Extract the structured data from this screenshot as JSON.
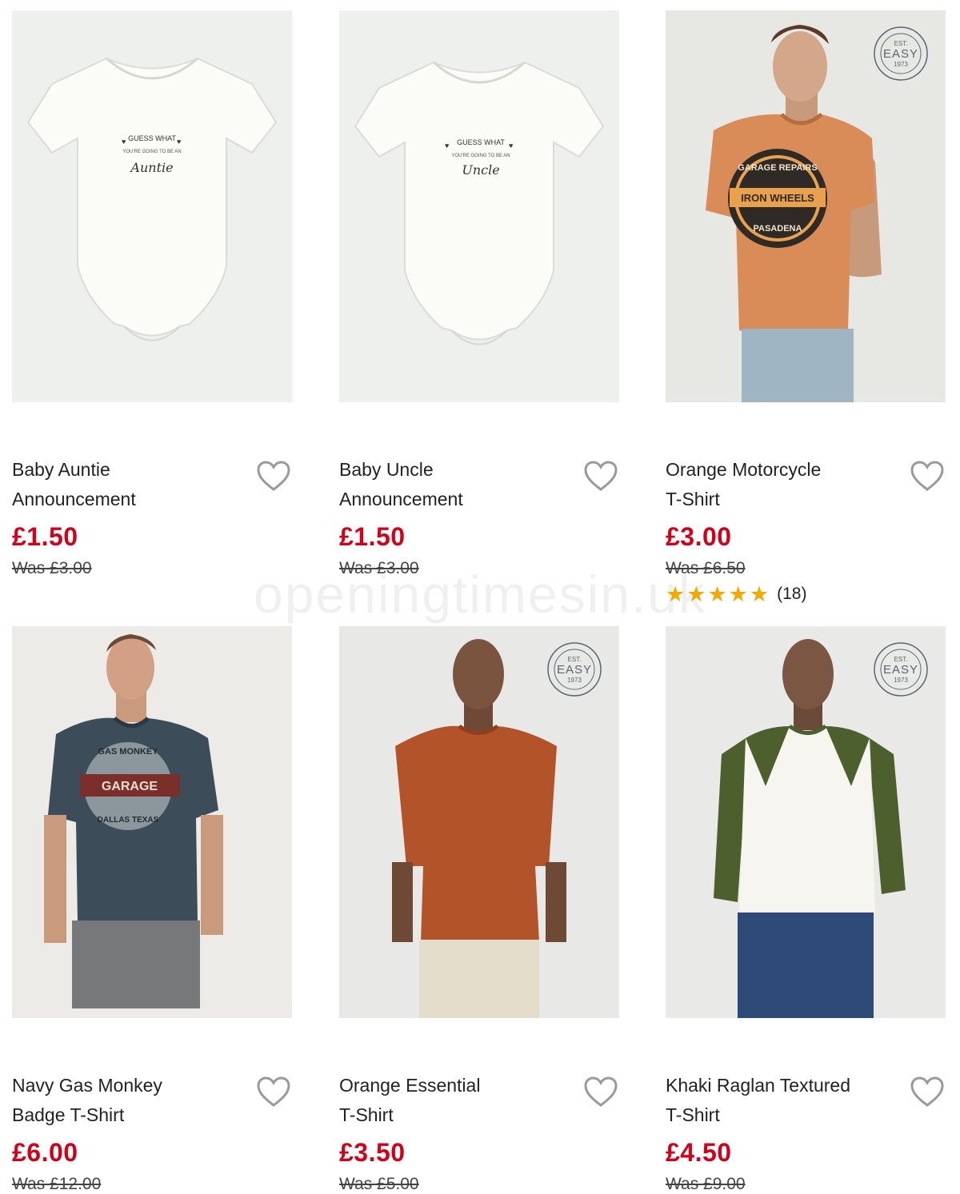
{
  "watermark": "openingtimesin.uk",
  "colors": {
    "sale_price": "#d0021b",
    "star": "#f2a900",
    "heart_outline": "#9a9a9a"
  },
  "badge": {
    "top": "EST.",
    "main": "EASY",
    "year": "1973"
  },
  "products": [
    {
      "name_line1": "Baby Auntie",
      "name_line2": "Announcement",
      "price": "£1.50",
      "was": "Was £3.00",
      "print_line1": "GUESS WHAT",
      "print_line2": "YOU'RE GOING TO BE AN",
      "print_line3": "Auntie"
    },
    {
      "name_line1": "Baby Uncle",
      "name_line2": "Announcement",
      "price": "£1.50",
      "was": "Was £3.00",
      "print_line1": "GUESS WHAT",
      "print_line2": "YOU'RE GOING TO BE AN",
      "print_line3": "Uncle"
    },
    {
      "name_line1": "Orange Motorcycle",
      "name_line2": "T-Shirt",
      "price": "£3.00",
      "was": "Was £6.50",
      "rating_stars": 5,
      "rating_count": "(18)",
      "print_line1": "GARAGE REPAIRS",
      "print_line2": "IRON WHEELS",
      "print_line3": "PASADENA"
    },
    {
      "name_line1": "Navy Gas Monkey",
      "name_line2": "Badge T-Shirt",
      "price": "£6.00",
      "was": "Was £12.00",
      "print_line1": "GAS MONKEY",
      "print_line2": "GARAGE",
      "print_line3": "DALLAS TEXAS"
    },
    {
      "name_line1": "Orange Essential",
      "name_line2": "T-Shirt",
      "price": "£3.50",
      "was": "Was £5.00"
    },
    {
      "name_line1": "Khaki Raglan Textured",
      "name_line2": "T-Shirt",
      "price": "£4.50",
      "was": "Was £9.00"
    }
  ]
}
